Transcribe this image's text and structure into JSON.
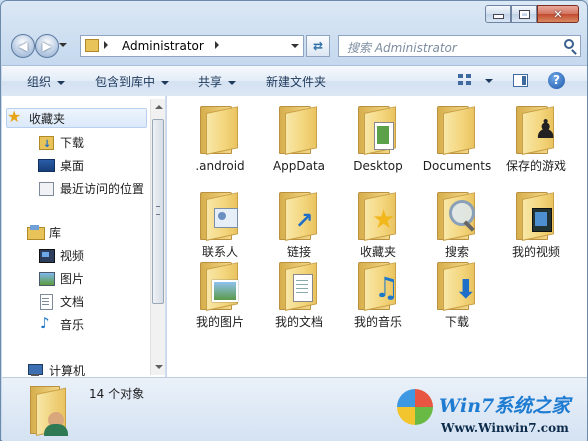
{
  "window": {
    "address_path": "Administrator",
    "search_placeholder": "搜索 Administrator"
  },
  "toolbar": {
    "organize": "组织",
    "include_in_library": "包含到库中",
    "share": "共享",
    "new_folder": "新建文件夹"
  },
  "navpane": {
    "favorites": "收藏夹",
    "downloads": "下载",
    "desktop": "桌面",
    "recent": "最近访问的位置",
    "libraries": "库",
    "videos": "视频",
    "pictures": "图片",
    "documents": "文档",
    "music": "音乐",
    "computer": "计算机"
  },
  "files": [
    {
      "label": ".android",
      "icon": "folder-icon"
    },
    {
      "label": "AppData",
      "icon": "folder-icon"
    },
    {
      "label": "Desktop",
      "icon": "desktop-folder-icon"
    },
    {
      "label": "Documents",
      "icon": "folder-icon"
    },
    {
      "label": "保存的游戏",
      "icon": "saved-games-folder-icon"
    },
    {
      "label": "联系人",
      "icon": "contacts-folder-icon"
    },
    {
      "label": "链接",
      "icon": "links-folder-icon"
    },
    {
      "label": "收藏夹",
      "icon": "favorites-folder-icon"
    },
    {
      "label": "搜索",
      "icon": "searches-folder-icon"
    },
    {
      "label": "我的视频",
      "icon": "videos-folder-icon"
    },
    {
      "label": "我的图片",
      "icon": "pictures-folder-icon"
    },
    {
      "label": "我的文档",
      "icon": "documents-folder-icon"
    },
    {
      "label": "我的音乐",
      "icon": "music-folder-icon"
    },
    {
      "label": "下载",
      "icon": "downloads-folder-icon"
    }
  ],
  "status": {
    "count": "14 个对象"
  },
  "watermark": {
    "brand": "Win7系统之家",
    "url": "Www.Winwin7.com"
  }
}
